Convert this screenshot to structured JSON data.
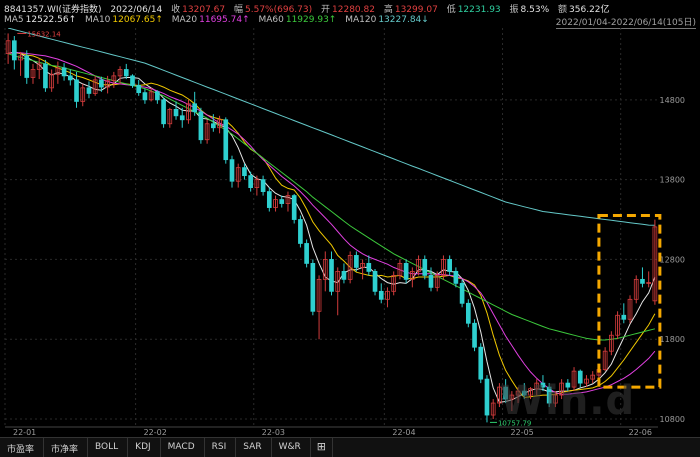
{
  "header": {
    "code": "8841357.WI(证券指数)",
    "date": "2022/06/14",
    "close_label": "收",
    "close_value": "13207.67",
    "change_label": "幅",
    "change_value": "5.57%(696.73)",
    "open_label": "开",
    "open_value": "12280.82",
    "high_label": "高",
    "high_value": "13299.07",
    "low_label": "低",
    "low_value": "12231.93",
    "amplitude_label": "振",
    "amplitude_value": "8.53%",
    "amount_label": "额",
    "amount_value": "356.22亿"
  },
  "ma": {
    "ma5_label": "MA5",
    "ma5_value": "12522.56↑",
    "ma10_label": "MA10",
    "ma10_value": "12067.65↑",
    "ma20_label": "MA20",
    "ma20_value": "11695.74↑",
    "ma60_label": "MA60",
    "ma60_value": "11929.93↑",
    "ma120_label": "MA120",
    "ma120_value": "13227.84↓"
  },
  "range_text": "2022/01/04-2022/06/14(105日)",
  "tabs": [
    "市盈率",
    "市净率",
    "BOLL",
    "KDJ",
    "MACD",
    "RSI",
    "SAR",
    "W&R",
    "⊞"
  ],
  "watermark": "Win.d",
  "colors": {
    "up": "#d23c3c",
    "down": "#2fd0d0",
    "ma5": "#e6e6e6",
    "ma10": "#f0c800",
    "ma20": "#e040e0",
    "ma60": "#3cc83c",
    "ma120": "#64c8c8",
    "highlight": "#f5a800",
    "background": "#000000"
  },
  "chart_data": {
    "type": "candlestick",
    "x_tick_labels": [
      "22-01",
      "22-02",
      "22-03",
      "22-04",
      "22-05",
      "22-06"
    ],
    "x_tick_index": [
      0,
      21,
      40,
      61,
      80,
      99
    ],
    "y_tick_labels": [
      "14800",
      "13800",
      "12800",
      "11800",
      "10800"
    ],
    "y_ticks": [
      14800,
      13800,
      12800,
      11800,
      10800
    ],
    "ylim": [
      10700,
      15700
    ],
    "max_annotation": {
      "label": "15632.14",
      "index": 1,
      "value": 15632.14
    },
    "min_annotation": {
      "label": "10757.79",
      "index": 77,
      "value": 10757.79
    },
    "highlight_range": {
      "from_index": 96,
      "to_index": 104,
      "y_from": 11200,
      "y_to": 13350
    },
    "ohlc": [
      [
        15380,
        15632,
        15250,
        15540
      ],
      [
        15540,
        15600,
        15180,
        15300
      ],
      [
        15300,
        15400,
        15100,
        15350
      ],
      [
        15350,
        15420,
        15000,
        15080
      ],
      [
        15080,
        15250,
        15000,
        15180
      ],
      [
        15180,
        15320,
        15060,
        15250
      ],
      [
        15250,
        15300,
        14900,
        14950
      ],
      [
        14950,
        15180,
        14900,
        15120
      ],
      [
        15120,
        15280,
        15000,
        15200
      ],
      [
        15200,
        15260,
        15040,
        15100
      ],
      [
        15100,
        15180,
        14980,
        15050
      ],
      [
        15050,
        15150,
        14700,
        14780
      ],
      [
        14780,
        15000,
        14720,
        14950
      ],
      [
        14950,
        15030,
        14820,
        14880
      ],
      [
        14880,
        15100,
        14850,
        15050
      ],
      [
        15050,
        15090,
        14900,
        14960
      ],
      [
        14960,
        15100,
        14880,
        15040
      ],
      [
        15040,
        15150,
        14950,
        15100
      ],
      [
        15100,
        15220,
        15000,
        15180
      ],
      [
        15180,
        15250,
        15060,
        15100
      ],
      [
        15100,
        15120,
        14950,
        14980
      ],
      [
        14980,
        15050,
        14850,
        14890
      ],
      [
        14890,
        14940,
        14750,
        14800
      ],
      [
        14800,
        14950,
        14780,
        14900
      ],
      [
        14900,
        14920,
        14750,
        14800
      ],
      [
        14800,
        14830,
        14450,
        14500
      ],
      [
        14500,
        14700,
        14450,
        14680
      ],
      [
        14680,
        14780,
        14550,
        14600
      ],
      [
        14600,
        14700,
        14450,
        14550
      ],
      [
        14550,
        14800,
        14500,
        14750
      ],
      [
        14750,
        14900,
        14600,
        14650
      ],
      [
        14650,
        14700,
        14250,
        14300
      ],
      [
        14300,
        14550,
        14250,
        14500
      ],
      [
        14500,
        14620,
        14400,
        14450
      ],
      [
        14450,
        14600,
        14380,
        14550
      ],
      [
        14550,
        14580,
        14000,
        14050
      ],
      [
        14050,
        14100,
        13700,
        13780
      ],
      [
        13780,
        14000,
        13700,
        13950
      ],
      [
        13950,
        14000,
        13800,
        13850
      ],
      [
        13850,
        13900,
        13650,
        13700
      ],
      [
        13700,
        13850,
        13600,
        13800
      ],
      [
        13800,
        13850,
        13600,
        13650
      ],
      [
        13650,
        13700,
        13400,
        13450
      ],
      [
        13450,
        13600,
        13400,
        13550
      ],
      [
        13550,
        13600,
        13450,
        13500
      ],
      [
        13500,
        13650,
        13400,
        13600
      ],
      [
        13600,
        13620,
        13250,
        13300
      ],
      [
        13300,
        13350,
        12950,
        13000
      ],
      [
        13000,
        13050,
        12700,
        12750
      ],
      [
        12750,
        12800,
        12100,
        12150
      ],
      [
        12150,
        12600,
        11800,
        12550
      ],
      [
        12550,
        12900,
        12400,
        12800
      ],
      [
        12800,
        12900,
        12350,
        12400
      ],
      [
        12400,
        12700,
        12100,
        12650
      ],
      [
        12650,
        12750,
        12500,
        12550
      ],
      [
        12550,
        12900,
        12500,
        12850
      ],
      [
        12850,
        12900,
        12650,
        12700
      ],
      [
        12700,
        12800,
        12550,
        12750
      ],
      [
        12750,
        12850,
        12600,
        12650
      ],
      [
        12650,
        12680,
        12350,
        12400
      ],
      [
        12400,
        12500,
        12250,
        12300
      ],
      [
        12300,
        12450,
        12200,
        12400
      ],
      [
        12400,
        12650,
        12350,
        12600
      ],
      [
        12600,
        12800,
        12550,
        12750
      ],
      [
        12750,
        12800,
        12500,
        12550
      ],
      [
        12550,
        12700,
        12450,
        12650
      ],
      [
        12650,
        12850,
        12600,
        12800
      ],
      [
        12800,
        12850,
        12550,
        12600
      ],
      [
        12600,
        12700,
        12400,
        12450
      ],
      [
        12450,
        12650,
        12400,
        12600
      ],
      [
        12600,
        12850,
        12550,
        12800
      ],
      [
        12800,
        12850,
        12600,
        12650
      ],
      [
        12650,
        12700,
        12450,
        12500
      ],
      [
        12500,
        12550,
        12200,
        12250
      ],
      [
        12250,
        12300,
        11950,
        12000
      ],
      [
        12000,
        12050,
        11650,
        11700
      ],
      [
        11700,
        11750,
        11250,
        11300
      ],
      [
        11300,
        11350,
        10757.79,
        10850
      ],
      [
        10850,
        11050,
        10800,
        11000
      ],
      [
        11000,
        11250,
        10950,
        11200
      ],
      [
        11200,
        11300,
        11000,
        11050
      ],
      [
        11050,
        11150,
        10900,
        11100
      ],
      [
        11100,
        11200,
        11000,
        11150
      ],
      [
        11150,
        11250,
        11050,
        11100
      ],
      [
        11100,
        11200,
        11050,
        11180
      ],
      [
        11180,
        11300,
        11100,
        11250
      ],
      [
        11250,
        11350,
        11150,
        11200
      ],
      [
        11200,
        11250,
        10950,
        11000
      ],
      [
        11000,
        11150,
        10950,
        11100
      ],
      [
        11100,
        11300,
        11050,
        11250
      ],
      [
        11250,
        11300,
        11150,
        11200
      ],
      [
        11200,
        11450,
        11150,
        11400
      ],
      [
        11400,
        11420,
        11200,
        11250
      ],
      [
        11250,
        11350,
        11200,
        11300
      ],
      [
        11300,
        11400,
        11250,
        11350
      ],
      [
        11350,
        11450,
        11300,
        11420
      ],
      [
        11420,
        11700,
        11400,
        11650
      ],
      [
        11650,
        11900,
        11600,
        11850
      ],
      [
        11850,
        12150,
        11800,
        12100
      ],
      [
        12100,
        12250,
        12000,
        12050
      ],
      [
        12050,
        12350,
        12000,
        12300
      ],
      [
        12300,
        12600,
        12250,
        12550
      ],
      [
        12550,
        12700,
        12450,
        12500
      ],
      [
        12500,
        12650,
        12450,
        12511
      ],
      [
        12280.82,
        13299.07,
        12231.93,
        13207.67
      ]
    ],
    "series": [
      {
        "name": "MA5",
        "values": [
          15380,
          15400,
          15380,
          15330,
          15290,
          15240,
          15160,
          15110,
          15140,
          15120,
          15090,
          15040,
          15000,
          14970,
          14930,
          14920,
          14970,
          15000,
          15070,
          15080,
          15080,
          15070,
          15000,
          14950,
          14900,
          14820,
          14760,
          14720,
          14670,
          14660,
          14660,
          14570,
          14560,
          14530,
          14490,
          14450,
          14350,
          14200,
          14010,
          13870,
          13810,
          13790,
          13700,
          13630,
          13590,
          13580,
          13550,
          13410,
          13230,
          12950,
          12750,
          12580,
          12530,
          12510,
          12630,
          12670,
          12670,
          12700,
          12700,
          12630,
          12560,
          12510,
          12490,
          12510,
          12500,
          12560,
          12670,
          12670,
          12650,
          12610,
          12670,
          12650,
          12640,
          12560,
          12410,
          12190,
          11890,
          11520,
          11190,
          11010,
          11020,
          11040,
          11080,
          11120,
          11160,
          11180,
          11170,
          11140,
          11140,
          11150,
          11150,
          11160,
          11190,
          11210,
          11240,
          11300,
          11380,
          11490,
          11660,
          11820,
          11990,
          12120,
          12270,
          12380,
          12580
        ]
      },
      {
        "name": "MA10",
        "values": [
          15380,
          15390,
          15380,
          15360,
          15350,
          15320,
          15280,
          15230,
          15200,
          15170,
          15140,
          15100,
          15080,
          15050,
          15020,
          14990,
          14990,
          14990,
          15000,
          15000,
          14990,
          14980,
          14990,
          15010,
          14990,
          14960,
          14920,
          14890,
          14860,
          14810,
          14750,
          14670,
          14610,
          14580,
          14560,
          14540,
          14470,
          14380,
          14270,
          14180,
          14130,
          14070,
          13950,
          13820,
          13730,
          13690,
          13670,
          13570,
          13430,
          13270,
          13160,
          13070,
          12980,
          12850,
          12780,
          12700,
          12640,
          12620,
          12600,
          12590,
          12600,
          12580,
          12590,
          12600,
          12560,
          12560,
          12580,
          12580,
          12580,
          12580,
          12590,
          12600,
          12570,
          12560,
          12530,
          12480,
          12350,
          12130,
          11850,
          11600,
          11410,
          11280,
          11160,
          11070,
          11080,
          11090,
          11100,
          11100,
          11110,
          11130,
          11150,
          11160,
          11170,
          11180,
          11190,
          11220,
          11270,
          11340,
          11440,
          11540,
          11650,
          11760,
          11870,
          11980,
          12120
        ]
      },
      {
        "name": "MA20",
        "values": [
          15380,
          15390,
          15390,
          15380,
          15370,
          15360,
          15350,
          15330,
          15310,
          15280,
          15250,
          15220,
          15180,
          15140,
          15100,
          15060,
          15030,
          15010,
          15000,
          14990,
          14980,
          14970,
          14960,
          14940,
          14910,
          14880,
          14840,
          14810,
          14780,
          14740,
          14700,
          14660,
          14610,
          14560,
          14510,
          14470,
          14420,
          14370,
          14300,
          14220,
          14130,
          14050,
          13980,
          13910,
          13840,
          13780,
          13720,
          13650,
          13570,
          13480,
          13400,
          13320,
          13240,
          13150,
          13060,
          12980,
          12920,
          12870,
          12830,
          12800,
          12770,
          12740,
          12700,
          12670,
          12640,
          12620,
          12620,
          12620,
          12620,
          12610,
          12610,
          12600,
          12590,
          12560,
          12520,
          12460,
          12380,
          12260,
          12120,
          11980,
          11840,
          11720,
          11600,
          11490,
          11390,
          11310,
          11240,
          11180,
          11130,
          11110,
          11110,
          11120,
          11130,
          11140,
          11160,
          11180,
          11200,
          11230,
          11270,
          11310,
          11360,
          11420,
          11490,
          11560,
          11650
        ]
      },
      {
        "name": "MA60",
        "values": [
          15380,
          15350,
          15330,
          15310,
          15290,
          15270,
          15250,
          15230,
          15220,
          15200,
          15180,
          15160,
          15140,
          15120,
          15100,
          15080,
          15060,
          15040,
          15020,
          15000,
          14980,
          14960,
          14940,
          14910,
          14880,
          14850,
          14810,
          14770,
          14730,
          14690,
          14650,
          14610,
          14570,
          14520,
          14470,
          14420,
          14370,
          14310,
          14250,
          14190,
          14130,
          14070,
          14010,
          13950,
          13890,
          13830,
          13770,
          13710,
          13650,
          13580,
          13520,
          13460,
          13400,
          13340,
          13280,
          13220,
          13170,
          13120,
          13070,
          13020,
          12970,
          12920,
          12870,
          12830,
          12790,
          12750,
          12710,
          12670,
          12630,
          12590,
          12550,
          12510,
          12470,
          12430,
          12390,
          12350,
          12310,
          12270,
          12230,
          12190,
          12150,
          12110,
          12080,
          12050,
          12020,
          11990,
          11960,
          11930,
          11910,
          11890,
          11870,
          11850,
          11830,
          11810,
          11800,
          11790,
          11790,
          11800,
          11810,
          11830,
          11850,
          11870,
          11890,
          11910,
          11930
        ]
      },
      {
        "name": "MA120",
        "values": [
          15700,
          15680,
          15660,
          15640,
          15620,
          15600,
          15580,
          15560,
          15540,
          15520,
          15500,
          15480,
          15460,
          15440,
          15420,
          15400,
          15380,
          15360,
          15340,
          15320,
          15300,
          15280,
          15260,
          15230,
          15200,
          15170,
          15140,
          15110,
          15080,
          15050,
          15020,
          14990,
          14960,
          14930,
          14900,
          14870,
          14840,
          14810,
          14780,
          14750,
          14720,
          14690,
          14660,
          14630,
          14600,
          14570,
          14540,
          14510,
          14480,
          14450,
          14420,
          14390,
          14360,
          14330,
          14300,
          14270,
          14240,
          14210,
          14180,
          14150,
          14120,
          14090,
          14060,
          14030,
          14000,
          13970,
          13940,
          13910,
          13880,
          13850,
          13820,
          13790,
          13760,
          13730,
          13700,
          13670,
          13640,
          13610,
          13580,
          13550,
          13520,
          13500,
          13480,
          13460,
          13440,
          13420,
          13400,
          13390,
          13380,
          13370,
          13360,
          13350,
          13340,
          13330,
          13320,
          13310,
          13300,
          13290,
          13280,
          13270,
          13260,
          13250,
          13240,
          13230,
          13227.84
        ]
      }
    ]
  }
}
